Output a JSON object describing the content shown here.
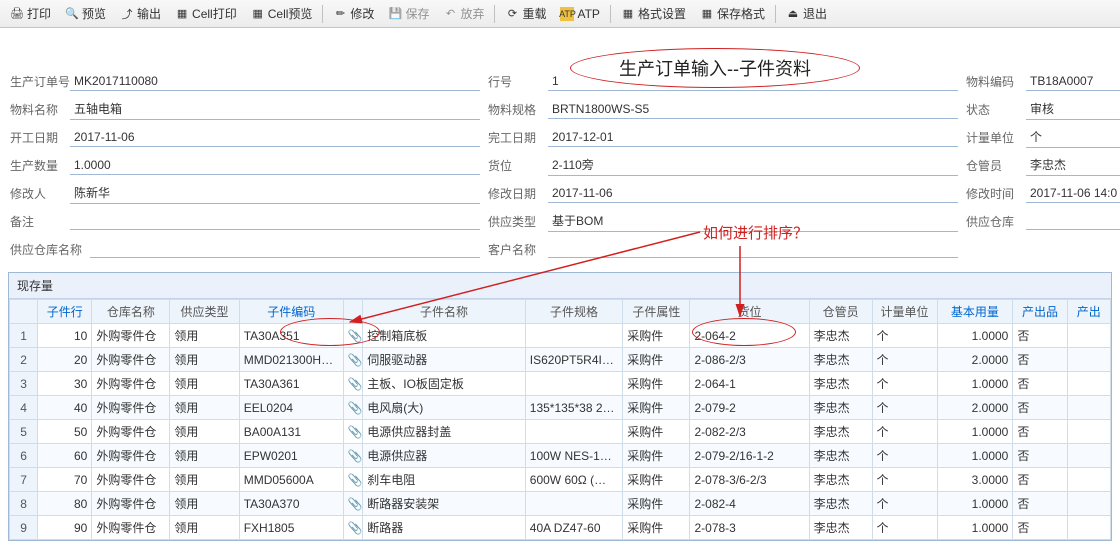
{
  "toolbar": {
    "print": "打印",
    "preview": "预览",
    "output": "输出",
    "cellPrint": "Cell打印",
    "cellPreview": "Cell预览",
    "edit": "修改",
    "save": "保存",
    "abandon": "放弃",
    "reload": "重载",
    "atp": "ATP",
    "formatSet": "格式设置",
    "saveFormat": "保存格式",
    "exit": "退出"
  },
  "title": "生产订单输入--子件资料",
  "annotation": "如何进行排序？",
  "form": {
    "left": {
      "orderNoLabel": "生产订单号",
      "orderNo": "MK2017110080",
      "matNameLabel": "物料名称",
      "matName": "五轴电箱",
      "startDateLabel": "开工日期",
      "startDate": "2017-11-06",
      "qtyLabel": "生产数量",
      "qty": "1.0000",
      "modByLabel": "修改人",
      "modBy": "陈新华",
      "remarkLabel": "备注",
      "remark": "",
      "supWhNameLabel": "供应仓库名称",
      "supWhName": ""
    },
    "mid": {
      "lineNoLabel": "行号",
      "lineNo": "1",
      "matSpecLabel": "物料规格",
      "matSpec": "BRTN1800WS-S5",
      "endDateLabel": "完工日期",
      "endDate": "2017-12-01",
      "binLabel": "货位",
      "bin": "2-110旁",
      "modDateLabel": "修改日期",
      "modDate": "2017-11-06",
      "supTypeLabel": "供应类型",
      "supType": "基于BOM",
      "custNameLabel": "客户名称",
      "custName": ""
    },
    "right": {
      "matCodeLabel": "物料编码",
      "matCode": "TB18A0007",
      "statusLabel": "状态",
      "status": "审核",
      "uomLabel": "计量单位",
      "uom": "个",
      "keeperLabel": "仓管员",
      "keeper": "李忠杰",
      "modTimeLabel": "修改时间",
      "modTime": "2017-11-06 14:0",
      "supWhLabel": "供应仓库",
      "supWh": ""
    }
  },
  "tableTitle": "现存量",
  "columns": {
    "row": "",
    "childLine": "子件行",
    "whName": "仓库名称",
    "supType": "供应类型",
    "childCode": "子件编码",
    "clip": "",
    "childName": "子件名称",
    "childSpec": "子件规格",
    "childAttr": "子件属性",
    "bin": "货位",
    "keeper": "仓管员",
    "uom": "计量单位",
    "baseQty": "基本用量",
    "output": "产出品",
    "outRate": "产出"
  },
  "rows": [
    {
      "n": "1",
      "line": "10",
      "wh": "外购零件仓",
      "typ": "领用",
      "code": "TA30A351",
      "name": "控制箱底板",
      "spec": "",
      "attr": "采购件",
      "bin": "2-064-2",
      "keep": "李忠杰",
      "uom": "个",
      "qty": "1.0000",
      "out": "否"
    },
    {
      "n": "2",
      "line": "20",
      "wh": "外购零件仓",
      "typ": "领用",
      "code": "MMD021300H…",
      "name": "伺服驱动器",
      "spec": "IS620PT5R4I…",
      "attr": "采购件",
      "bin": "2-086-2/3",
      "keep": "李忠杰",
      "uom": "个",
      "qty": "2.0000",
      "out": "否"
    },
    {
      "n": "3",
      "line": "30",
      "wh": "外购零件仓",
      "typ": "领用",
      "code": "TA30A361",
      "name": "主板、IO板固定板",
      "spec": "",
      "attr": "采购件",
      "bin": "2-064-1",
      "keep": "李忠杰",
      "uom": "个",
      "qty": "1.0000",
      "out": "否"
    },
    {
      "n": "4",
      "line": "40",
      "wh": "外购零件仓",
      "typ": "领用",
      "code": "EEL0204",
      "name": "电风扇(大)",
      "spec": "135*135*38 2…",
      "attr": "采购件",
      "bin": "2-079-2",
      "keep": "李忠杰",
      "uom": "个",
      "qty": "2.0000",
      "out": "否"
    },
    {
      "n": "5",
      "line": "50",
      "wh": "外购零件仓",
      "typ": "领用",
      "code": "BA00A131",
      "name": "电源供应器封盖",
      "spec": "",
      "attr": "采购件",
      "bin": "2-082-2/3",
      "keep": "李忠杰",
      "uom": "个",
      "qty": "1.0000",
      "out": "否"
    },
    {
      "n": "6",
      "line": "60",
      "wh": "外购零件仓",
      "typ": "领用",
      "code": "EPW0201",
      "name": "电源供应器",
      "spec": "100W NES-1…",
      "attr": "采购件",
      "bin": "2-079-2/16-1-2",
      "keep": "李忠杰",
      "uom": "个",
      "qty": "1.0000",
      "out": "否"
    },
    {
      "n": "7",
      "line": "70",
      "wh": "外购零件仓",
      "typ": "领用",
      "code": "MMD05600A",
      "name": "刹车电阻",
      "spec": "600W 60Ω (…",
      "attr": "采购件",
      "bin": "2-078-3/6-2/3",
      "keep": "李忠杰",
      "uom": "个",
      "qty": "3.0000",
      "out": "否"
    },
    {
      "n": "8",
      "line": "80",
      "wh": "外购零件仓",
      "typ": "领用",
      "code": "TA30A370",
      "name": "断路器安装架",
      "spec": "",
      "attr": "采购件",
      "bin": "2-082-4",
      "keep": "李忠杰",
      "uom": "个",
      "qty": "1.0000",
      "out": "否"
    },
    {
      "n": "9",
      "line": "90",
      "wh": "外购零件仓",
      "typ": "领用",
      "code": "FXH1805",
      "name": "断路器",
      "spec": "40A DZ47-60",
      "attr": "采购件",
      "bin": "2-078-3",
      "keep": "李忠杰",
      "uom": "个",
      "qty": "1.0000",
      "out": "否"
    }
  ]
}
